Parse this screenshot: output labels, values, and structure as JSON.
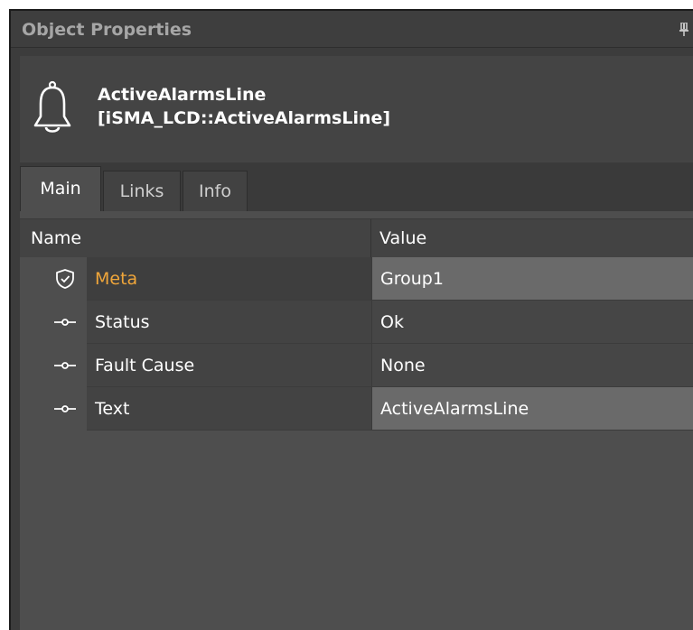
{
  "window": {
    "title": "Object Properties"
  },
  "object": {
    "icon": "bell-icon",
    "name": "ActiveAlarmsLine",
    "type": "[iSMA_LCD::ActiveAlarmsLine]"
  },
  "tabs": [
    {
      "label": "Main",
      "active": true
    },
    {
      "label": "Links",
      "active": false
    },
    {
      "label": "Info",
      "active": false
    }
  ],
  "table": {
    "columns": {
      "name": "Name",
      "value": "Value"
    },
    "rows": [
      {
        "icon": "shield-icon",
        "name": "Meta",
        "value": "Group1",
        "editable": true,
        "highlight": true
      },
      {
        "icon": "slot-connector-icon",
        "name": "Status",
        "value": "Ok",
        "editable": false
      },
      {
        "icon": "slot-connector-icon",
        "name": "Fault Cause",
        "value": "None",
        "editable": false
      },
      {
        "icon": "slot-connector-icon",
        "name": "Text",
        "value": "ActiveAlarmsLine",
        "editable": true
      }
    ]
  },
  "colors": {
    "meta_label": "#f0a63a",
    "editable_value_bg": "#6a6a6a",
    "panel_bg": "#4e4e4e"
  }
}
